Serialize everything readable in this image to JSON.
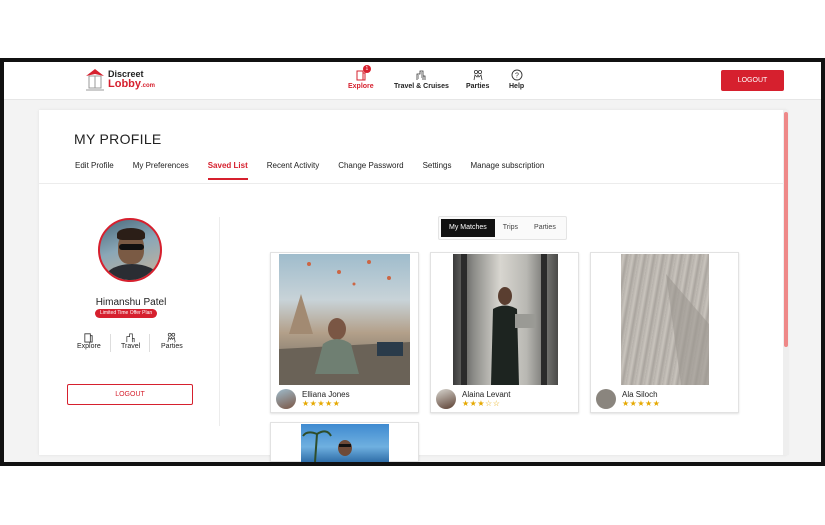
{
  "header": {
    "logo": {
      "line1": "Discreet",
      "line2": "Lobby",
      "suffix": ".com"
    },
    "nav": [
      {
        "label": "Explore",
        "icon": "explore-icon",
        "badge": "1"
      },
      {
        "label": "Travel & Cruises",
        "icon": "travel-icon"
      },
      {
        "label": "Parties",
        "icon": "parties-icon"
      },
      {
        "label": "Help",
        "icon": "help-icon"
      }
    ],
    "logout_label": "LOGOUT"
  },
  "profile": {
    "title": "MY PROFILE",
    "tabs": [
      "Edit Profile",
      "My Preferences",
      "Saved List",
      "Recent Activity",
      "Change Password",
      "Settings",
      "Manage subscription"
    ],
    "active_tab": "Saved List",
    "user": {
      "name": "Himanshu Patel",
      "plan": "Limited Time Offer Plan"
    },
    "quick_links": [
      "Explore",
      "Travel",
      "Parties"
    ],
    "logout_label": "LOGOUT"
  },
  "saved": {
    "segments": [
      "My Matches",
      "Trips",
      "Parties"
    ],
    "active_segment": "My Matches",
    "matches": [
      {
        "name": "Elliana Jones",
        "rating": 5,
        "stars": "★★★★★"
      },
      {
        "name": "Alaina Levant",
        "rating": 3,
        "stars": "★★★☆☆"
      },
      {
        "name": "Ala Siloch",
        "rating": 5,
        "stars": "★★★★★"
      },
      {
        "name": "",
        "rating": 0,
        "stars": ""
      }
    ]
  },
  "colors": {
    "brand": "#d6202e",
    "active_segment_bg": "#111111",
    "star": "#e5a800"
  }
}
